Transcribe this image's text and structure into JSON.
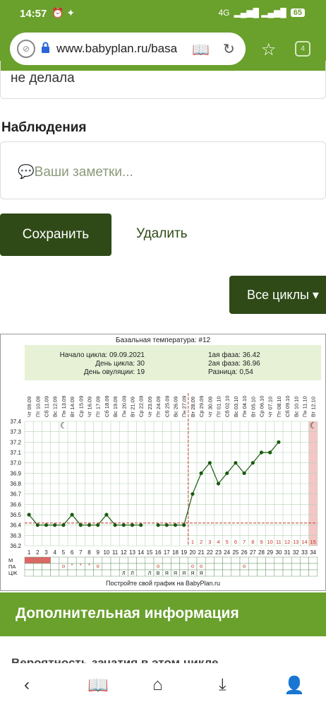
{
  "status": {
    "time": "14:57",
    "net": "4G",
    "battery": "65"
  },
  "browser": {
    "url": "www.babyplan.ru/basa",
    "tab_count": "4"
  },
  "form": {
    "prev_value": "не делала",
    "notes_title": "Наблюдения",
    "notes_placeholder": "Ваши заметки...",
    "save_label": "Сохранить",
    "delete_label": "Удалить",
    "cycles_label": "Все циклы"
  },
  "chart_info": {
    "cycle_start": "Начало цикла: 09.09.2021",
    "cycle_day": "День цикла: 30",
    "ovulation_day": "День овуляции: 19",
    "phase1": "1ая фаза: 36.42",
    "phase2": "2ая фаза: 36.96",
    "difference": "Разница: 0,54",
    "footer": "Постройте свой график на BabyPlan.ru"
  },
  "chart_data": {
    "type": "line",
    "title": "Базальная температура: #12",
    "ylim": [
      36.2,
      37.4
    ],
    "yticks": [
      "37.4",
      "37.3",
      "37.2",
      "37.1",
      "37.0",
      "36.9",
      "36.8",
      "36.7",
      "36.6",
      "36.5",
      "36.4",
      "36.3",
      "36.2"
    ],
    "x_dates": [
      "Чт 09.09",
      "Пт 10.09",
      "Сб 11.09",
      "Вс 12.09",
      "Пн 13.09",
      "Вт 14.09",
      "Ср 15.09",
      "Чт 16.09",
      "Пт 17.09",
      "Сб 18.09",
      "Вс 19.09",
      "Пн 20.09",
      "Вт 21.09",
      "Ср 22.09",
      "Чт 23.09",
      "Пт 24.09",
      "Сб 25.09",
      "Вс 26.09",
      "Пн 27.09",
      "Вт 28.09",
      "Ср 29.09",
      "Чт 30.09",
      "Пт 01.10",
      "Сб 02.10",
      "Вс 03.10",
      "Пн 04.10",
      "Вт 05.10",
      "Ср 06.10",
      "Чт 07.10",
      "Пт 08.10",
      "Сб 09.10",
      "Вс 10.10",
      "Пн 11.10",
      "Вт 12.10"
    ],
    "x_days": [
      "1",
      "2",
      "3",
      "4",
      "5",
      "6",
      "7",
      "8",
      "9",
      "10",
      "11",
      "12",
      "13",
      "14",
      "15",
      "16",
      "17",
      "18",
      "19",
      "20",
      "21",
      "22",
      "23",
      "24",
      "25",
      "26",
      "27",
      "28",
      "29",
      "30",
      "31",
      "32",
      "33",
      "34"
    ],
    "temperatures": [
      36.5,
      36.4,
      36.4,
      36.4,
      36.4,
      36.5,
      36.4,
      36.4,
      36.4,
      36.5,
      36.4,
      36.4,
      36.4,
      36.4,
      null,
      36.4,
      36.4,
      36.4,
      36.4,
      36.7,
      36.9,
      37.0,
      36.8,
      36.9,
      37.0,
      36.9,
      37.0,
      37.1,
      37.1,
      37.2
    ],
    "coverline": 36.42,
    "ovulation_day": 19,
    "phase2_days": [
      "1",
      "2",
      "3",
      "4",
      "5",
      "6",
      "7",
      "8",
      "9",
      "10",
      "11",
      "12",
      "13",
      "14",
      "15"
    ],
    "m_days": [
      1,
      2,
      3
    ],
    "pa_labels": {
      "6": "*",
      "7": "*",
      "8": "*",
      "5": "o",
      "9": "o",
      "16": "o",
      "20": "o",
      "21": "o",
      "26": "o"
    },
    "row_labels": [
      "М",
      "ПА",
      "ЦЖ"
    ],
    "cz_labels": {
      "12": "Л",
      "13": "Л",
      "15": "Л",
      "16": "В",
      "17": "Я",
      "18": "Я",
      "19": "Я",
      "20": "Я",
      "21": "Я"
    },
    "moon_days": [
      5,
      34
    ],
    "colors": {
      "line": "#1a5a10",
      "coverline": "#c0392b",
      "menses": "#e06666",
      "band": "#f4c6c6"
    }
  }
}
